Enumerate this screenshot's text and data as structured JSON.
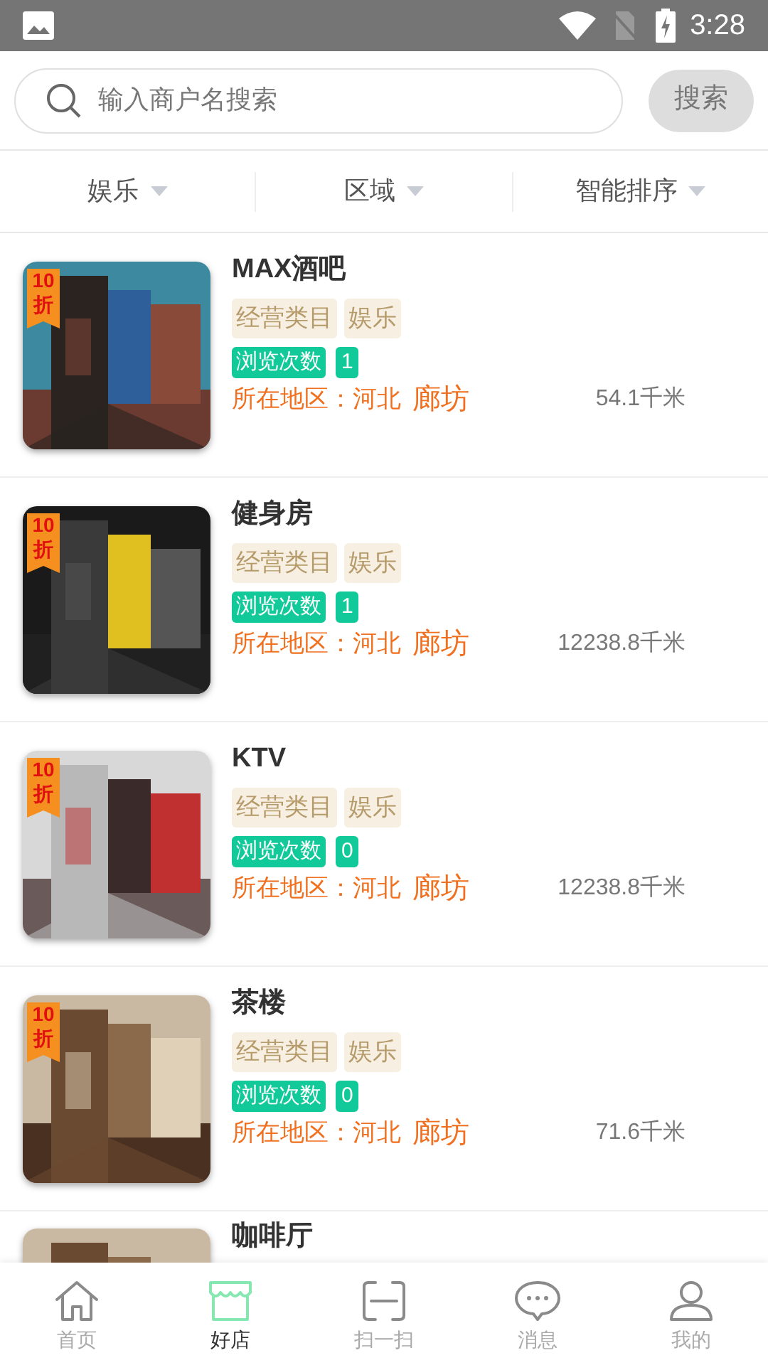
{
  "status_bar": {
    "time": "3:28"
  },
  "search": {
    "placeholder": "输入商户名搜索",
    "button": "搜索"
  },
  "filters": [
    {
      "label": "娱乐"
    },
    {
      "label": "区域"
    },
    {
      "label": "智能排序"
    }
  ],
  "shops": [
    {
      "name": "MAX酒吧",
      "discount": [
        "10",
        "折"
      ],
      "tags": [
        "经营类目",
        "娱乐"
      ],
      "views_label": "浏览次数",
      "views": "1",
      "region_label": "所在地区：",
      "province": "河北",
      "city": "廊坊",
      "distance": "54.1千米"
    },
    {
      "name": "健身房",
      "discount": [
        "10",
        "折"
      ],
      "tags": [
        "经营类目",
        "娱乐"
      ],
      "views_label": "浏览次数",
      "views": "1",
      "region_label": "所在地区：",
      "province": "河北",
      "city": "廊坊",
      "distance": "12238.8千米"
    },
    {
      "name": "KTV",
      "discount": [
        "10",
        "折"
      ],
      "tags": [
        "经营类目",
        "娱乐"
      ],
      "views_label": "浏览次数",
      "views": "0",
      "region_label": "所在地区：",
      "province": "河北",
      "city": "廊坊",
      "distance": "12238.8千米"
    },
    {
      "name": "茶楼",
      "discount": [
        "10",
        "折"
      ],
      "tags": [
        "经营类目",
        "娱乐"
      ],
      "views_label": "浏览次数",
      "views": "0",
      "region_label": "所在地区：",
      "province": "河北",
      "city": "廊坊",
      "distance": "71.6千米"
    },
    {
      "name": "咖啡厅"
    }
  ],
  "tabbar": [
    {
      "label": "首页",
      "selected": false
    },
    {
      "label": "好店",
      "selected": true
    },
    {
      "label": "扫一扫",
      "selected": false
    },
    {
      "label": "消息",
      "selected": false
    },
    {
      "label": "我的",
      "selected": false
    }
  ]
}
